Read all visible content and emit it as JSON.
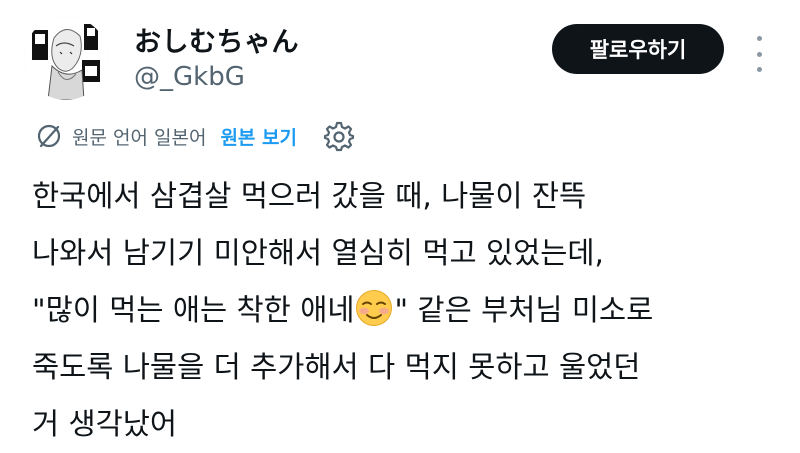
{
  "user": {
    "display_name": "おしむちゃん",
    "handle": "@_GkbG"
  },
  "follow_button": {
    "label": "팔로우하기"
  },
  "translation": {
    "source_label": "원문 언어 일본어",
    "show_original_label": "원본 보기"
  },
  "icons": {
    "translate": "translate-icon",
    "settings": "gear-icon",
    "more": "more-vertical-icon",
    "emoji": "smiling-face-emoji"
  },
  "tweet": {
    "lines": [
      "한국에서 삼겹살 먹으러 갔을 때, 나물이 잔뜩",
      "나와서 남기기 미안해서 열심히 먹고 있었는데,",
      "\"많이 먹는 애는 착한 애네",
      "\" 같은 부처님 미소로",
      "죽도록 나물을 더 추가해서 다 먹지 못하고 울었던",
      "거 생각났어"
    ]
  },
  "colors": {
    "text": "#0f1419",
    "secondary": "#536471",
    "link": "#1d9bf0",
    "button_bg": "#0f1419",
    "button_text": "#ffffff"
  }
}
